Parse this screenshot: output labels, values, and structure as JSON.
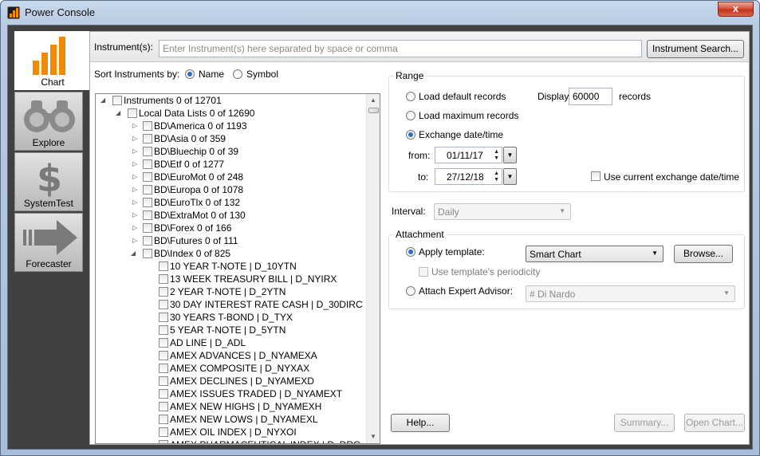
{
  "window": {
    "title": "Power Console",
    "close_label": "x"
  },
  "nav": [
    {
      "label": "Chart",
      "icon": "bar-chart-icon"
    },
    {
      "label": "Explore",
      "icon": "binoculars-icon"
    },
    {
      "label": "SystemTest",
      "icon": "dollar-icon"
    },
    {
      "label": "Forecaster",
      "icon": "arrow-right-icon"
    }
  ],
  "instrument": {
    "label": "Instrument(s):",
    "placeholder": "Enter Instrument(s) here separated by space or comma",
    "search_button": "Instrument Search..."
  },
  "sort": {
    "label": "Sort Instruments by:",
    "name": "Name",
    "symbol": "Symbol",
    "selected": "Name"
  },
  "tree": {
    "root": "Instruments  0 of 12701",
    "local": "Local Data Lists  0 of 12690",
    "groups": [
      "BD\\America  0 of 1193",
      "BD\\Asia  0 of 359",
      "BD\\Bluechip  0 of 39",
      "BD\\Etf  0 of 1277",
      "BD\\EuroMot  0 of 248",
      "BD\\Europa  0 of 1078",
      "BD\\EuroTlx  0 of 132",
      "BD\\ExtraMot  0 of 130",
      "BD\\Forex  0 of 166",
      "BD\\Futures  0 of 111",
      "BD\\Index  0 of 825"
    ],
    "index_items": [
      "10 YEAR T-NOTE | D_10YTN",
      "13 WEEK TREASURY BILL | D_NYIRX",
      "2 YEAR T-NOTE | D_2YTN",
      "30 DAY INTEREST RATE CASH | D_30DIRC",
      "30 YEARS T-BOND | D_TYX",
      "5 YEAR T-NOTE | D_5YTN",
      "AD LINE | D_ADL",
      "AMEX ADVANCES | D_NYAMEXA",
      "AMEX COMPOSITE | D_NYXAX",
      "AMEX DECLINES | D_NYAMEXD",
      "AMEX ISSUES TRADED | D_NYAMEXT",
      "AMEX NEW HIGHS | D_NYAMEXH",
      "AMEX NEW LOWS | D_NYAMEXL",
      "AMEX OIL INDEX | D_NYXOI",
      "AMEX PHARMACEUTICAL INDEX | D_DRG"
    ]
  },
  "range": {
    "title": "Range",
    "default_records": "Load default records",
    "display_label": "Display",
    "display_value": "60000",
    "records_label": "records",
    "max_records": "Load maximum records",
    "exchange_dt": "Exchange date/time",
    "selected": "Exchange date/time",
    "from_label": "from:",
    "from_value": "01/11/17",
    "to_label": "to:",
    "to_value": "27/12/18",
    "use_current": "Use current exchange date/time"
  },
  "interval": {
    "label": "Interval:",
    "value": "Daily"
  },
  "attachment": {
    "title": "Attachment",
    "apply_template": "Apply template:",
    "template_value": "Smart Chart",
    "browse": "Browse...",
    "use_periodicity": "Use template's periodicity",
    "attach_advisor": "Attach Expert Advisor:",
    "advisor_value": "# Di Nardo"
  },
  "buttons": {
    "help": "Help...",
    "summary": "Summary...",
    "open_chart": "Open Chart..."
  }
}
